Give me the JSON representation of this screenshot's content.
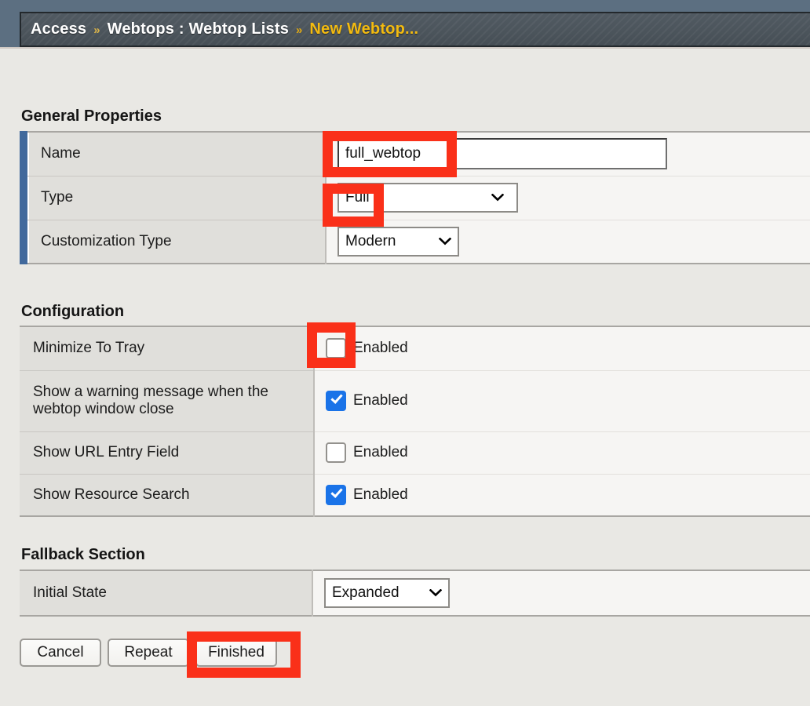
{
  "breadcrumb": {
    "items": [
      {
        "label": "Access",
        "active": false
      },
      {
        "label": "Webtops : Webtop Lists",
        "active": false
      },
      {
        "label": "New Webtop...",
        "active": true
      }
    ],
    "separator": "»"
  },
  "sections": {
    "general": {
      "title": "General Properties",
      "rows": [
        {
          "label": "Name",
          "control": "text",
          "value": "full_webtop",
          "placeholder": ""
        },
        {
          "label": "Type",
          "control": "select",
          "value": "Full"
        },
        {
          "label": "Customization Type",
          "control": "select",
          "value": "Modern"
        }
      ]
    },
    "configuration": {
      "title": "Configuration",
      "enabled_label": "Enabled",
      "rows": [
        {
          "label": "Minimize To Tray",
          "checked": false
        },
        {
          "label": "Show a warning message when the webtop window close",
          "checked": true
        },
        {
          "label": "Show URL Entry Field",
          "checked": false
        },
        {
          "label": "Show Resource Search",
          "checked": true
        }
      ]
    },
    "fallback": {
      "title": "Fallback Section",
      "rows": [
        {
          "label": "Initial State",
          "control": "select",
          "value": "Expanded"
        }
      ]
    }
  },
  "buttons": {
    "cancel": "Cancel",
    "repeat": "Repeat",
    "finished": "Finished"
  },
  "colors": {
    "annotation": "#fa3019",
    "accent_bar": "#41699c",
    "checkbox_checked": "#1a73e8",
    "breadcrumb_active": "#f3bb10",
    "page_background": "#e9e8e4",
    "header_background": "#5c6f81",
    "crumbbar_background": "#4c555d"
  },
  "icons": {
    "chevron_down": "⌄",
    "checkmark": "✓"
  }
}
